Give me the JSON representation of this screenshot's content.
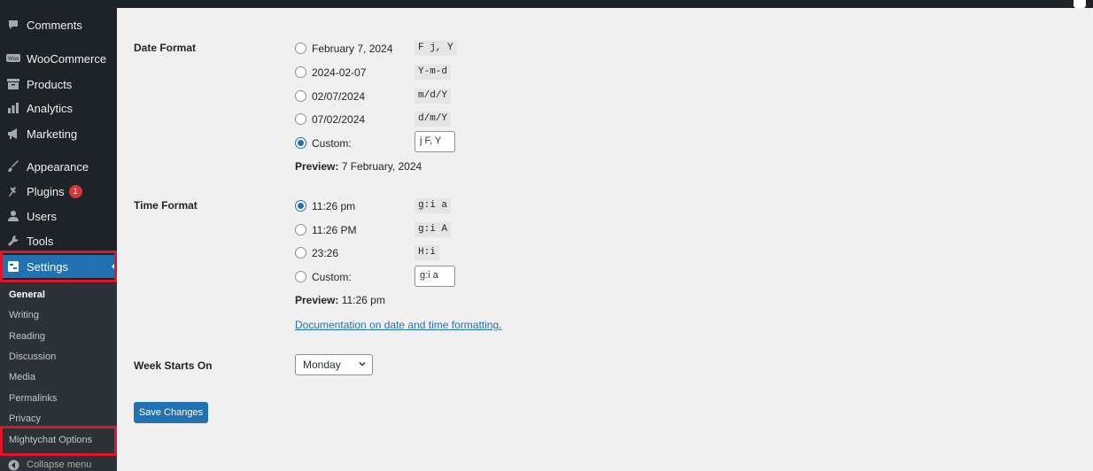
{
  "sidebar": {
    "items": [
      {
        "label": "Comments",
        "icon": "comment-icon"
      },
      {
        "label": "WooCommerce",
        "icon": "woocommerce-icon"
      },
      {
        "label": "Products",
        "icon": "products-icon"
      },
      {
        "label": "Analytics",
        "icon": "analytics-icon"
      },
      {
        "label": "Marketing",
        "icon": "megaphone-icon"
      },
      {
        "label": "Appearance",
        "icon": "paintbrush-icon"
      },
      {
        "label": "Plugins",
        "icon": "plugin-icon",
        "badge": "1"
      },
      {
        "label": "Users",
        "icon": "users-icon"
      },
      {
        "label": "Tools",
        "icon": "wrench-icon"
      },
      {
        "label": "Settings",
        "icon": "settings-icon"
      }
    ],
    "submenu": [
      "General",
      "Writing",
      "Reading",
      "Discussion",
      "Media",
      "Permalinks",
      "Privacy",
      "Mightychat Options"
    ],
    "collapse_label": "Collapse menu"
  },
  "date_format": {
    "label": "Date Format",
    "options": [
      {
        "text": "February 7, 2024",
        "code": "F j, Y"
      },
      {
        "text": "2024-02-07",
        "code": "Y-m-d"
      },
      {
        "text": "02/07/2024",
        "code": "m/d/Y"
      },
      {
        "text": "07/02/2024",
        "code": "d/m/Y"
      },
      {
        "text": "Custom:",
        "value": "j F, Y"
      }
    ],
    "preview_label": "Preview:",
    "preview_value": "7 February, 2024"
  },
  "time_format": {
    "label": "Time Format",
    "options": [
      {
        "text": "11:26 pm",
        "code": "g:i a"
      },
      {
        "text": "11:26 PM",
        "code": "g:i A"
      },
      {
        "text": "23:26",
        "code": "H:i"
      },
      {
        "text": "Custom:",
        "value": "g:i a"
      }
    ],
    "preview_label": "Preview:",
    "preview_value": "11:26 pm"
  },
  "doc_link": "Documentation on date and time formatting",
  "doc_link_tail": ".",
  "week_starts": {
    "label": "Week Starts On",
    "selected": "Monday"
  },
  "save_label": "Save Changes",
  "colors": {
    "sidebar_bg": "#1d2327",
    "accent": "#2271b1",
    "annotation_red": "#e0142a"
  }
}
